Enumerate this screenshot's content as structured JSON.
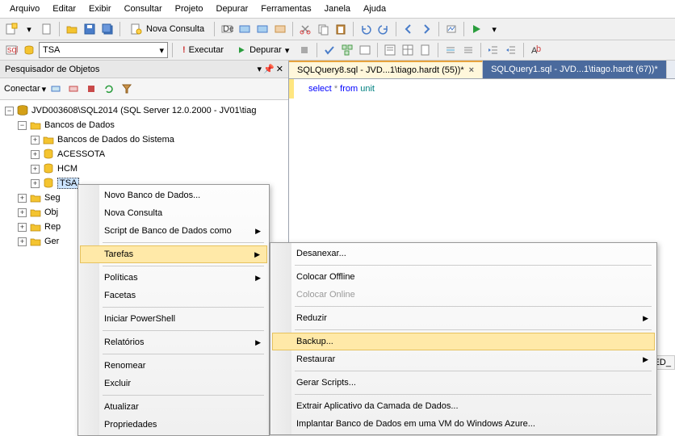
{
  "menu": [
    "Arquivo",
    "Editar",
    "Exibir",
    "Consultar",
    "Projeto",
    "Depurar",
    "Ferramentas",
    "Janela",
    "Ajuda"
  ],
  "toolbar1": {
    "new_query": "Nova Consulta"
  },
  "toolbar2": {
    "combo": "TSA",
    "execute": "Executar",
    "debug": "Depurar"
  },
  "panel": {
    "title": "Pesquisador de Objetos",
    "connect": "Conectar"
  },
  "tree": {
    "server": "JVD003608\\SQL2014 (SQL Server 12.0.2000 - JV01\\tiag",
    "dbs": "Bancos de Dados",
    "sysdb": "Bancos de Dados do Sistema",
    "db1": "ACESSOTA",
    "db2": "HCM",
    "db3": "TSA",
    "n1": "Seg",
    "n2": "Obj",
    "n3": "Rep",
    "n4": "Ger"
  },
  "ctx1": {
    "i1": "Novo Banco de Dados...",
    "i2": "Nova Consulta",
    "i3": "Script de Banco de Dados como",
    "i4": "Tarefas",
    "i5": "Políticas",
    "i6": "Facetas",
    "i7": "Iniciar PowerShell",
    "i8": "Relatórios",
    "i9": "Renomear",
    "i10": "Excluir",
    "i11": "Atualizar",
    "i12": "Propriedades"
  },
  "ctx2": {
    "i1": "Desanexar...",
    "i2": "Colocar Offline",
    "i3": "Colocar Online",
    "i4": "Reduzir",
    "i5": "Backup...",
    "i6": "Restaurar",
    "i7": "Gerar Scripts...",
    "i8": "Extrair Aplicativo da Camada de Dados...",
    "i9": "Implantar Banco de Dados em uma VM do Windows Azure..."
  },
  "tabs": {
    "t1": "SQLQuery8.sql - JVD...1\\tiago.hardt (55))*",
    "t2": "SQLQuery1.sql - JVD...1\\tiago.hardt (67))*"
  },
  "sql": {
    "kw1": "select",
    "op": "*",
    "kw2": "from",
    "tbl": "unit"
  },
  "grid_col": "ATED_"
}
